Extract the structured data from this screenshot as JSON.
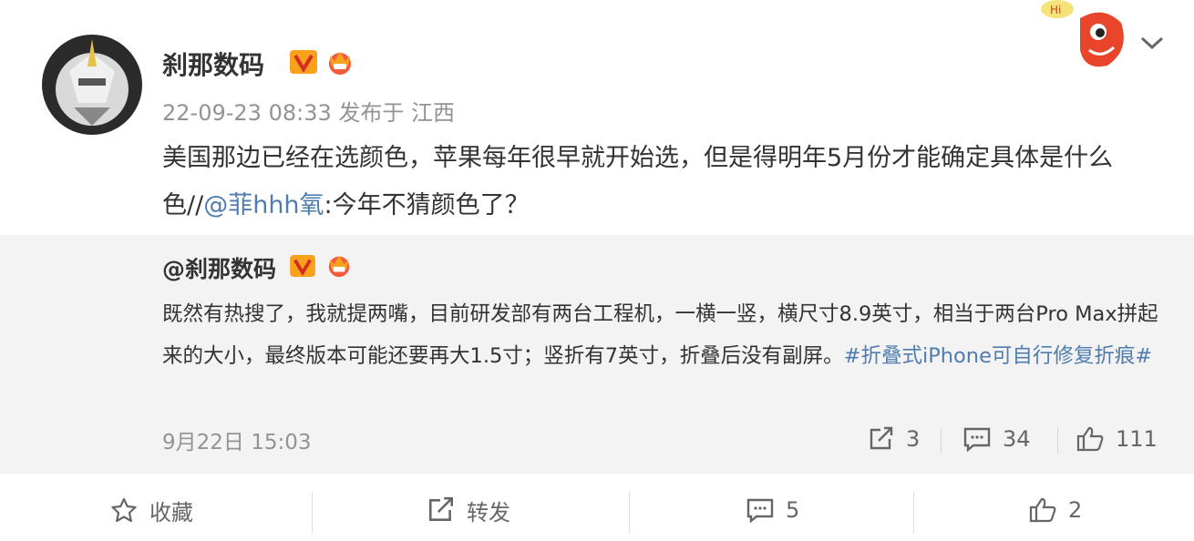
{
  "post": {
    "username": "刹那数码",
    "timestamp": "22-09-23 08:33",
    "published_label": "发布于",
    "location": "江西",
    "text_part1": "美国那边已经在选颜色，苹果每年很早就开始选，但是得明年5月份才能确定具体是什么色//",
    "mention": "@菲hhh氧",
    "text_part2": ":今年不猜颜色了？"
  },
  "quote": {
    "username": "@刹那数码",
    "text": "既然有热搜了，我就提两嘴，目前研发部有两台工程机，一横一竖，横尺寸8.9英寸，相当于两台Pro Max拼起来的大小，最终版本可能还要再大1.5寸；竖折有7英寸，折叠后没有副屏。",
    "hashtag": "#折叠式iPhone可自行修复折痕#",
    "time": "9月22日 15:03",
    "repost_count": "3",
    "comment_count": "34",
    "like_count": "111"
  },
  "actions": {
    "favorite_label": "收藏",
    "repost_label": "转发",
    "comment_count": "5",
    "like_count": "2"
  },
  "mascot_text": "Hi",
  "colors": {
    "link": "#507daf",
    "verified_badge": "#f7a11d",
    "crown_badge": "#f25b3c",
    "quote_bg": "#f3f3f3"
  }
}
